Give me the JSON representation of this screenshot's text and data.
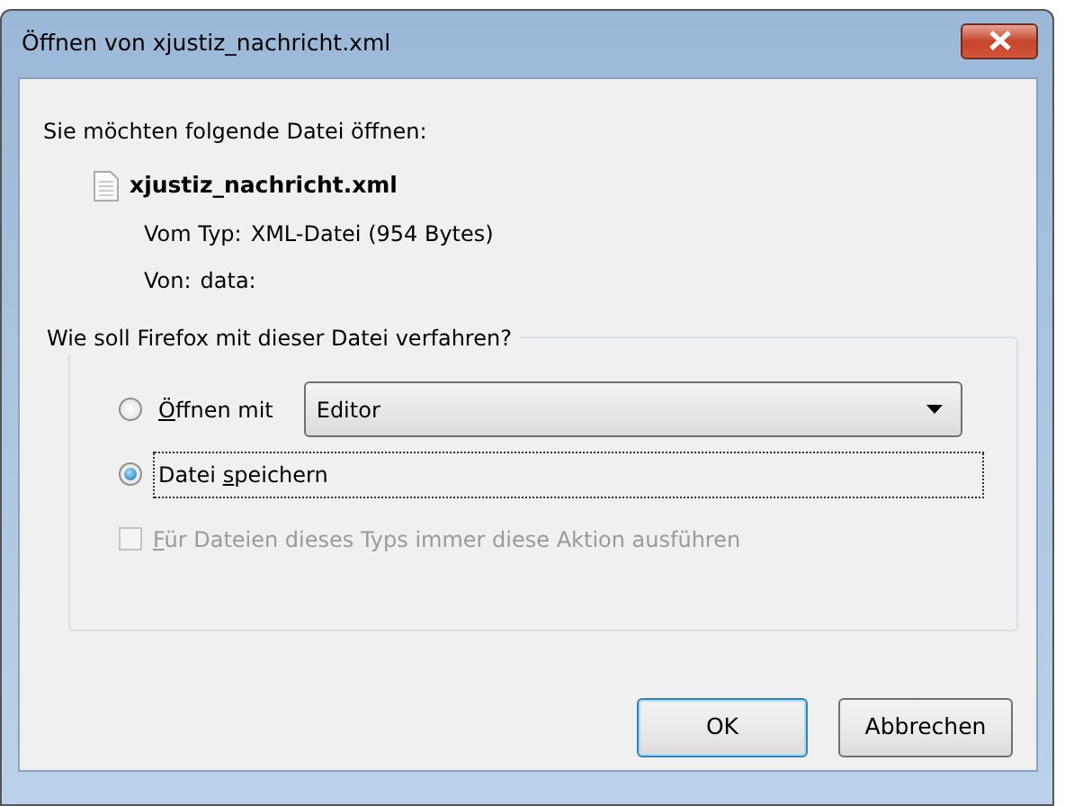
{
  "window": {
    "title": "Öffnen von xjustiz_nachricht.xml"
  },
  "prompt": "Sie möchten folgende Datei öffnen:",
  "file": {
    "name": "xjustiz_nachricht.xml",
    "type_label": "Vom Typ:",
    "type_value": "XML-Datei (954 Bytes)",
    "from_label": "Von:",
    "from_value": "data:"
  },
  "action_group": {
    "title": "Wie soll Firefox mit dieser Datei verfahren?",
    "options": [
      {
        "access_key": "Ö",
        "label_rest": "ffnen mit",
        "selected": false,
        "app": "Editor",
        "focused": false
      },
      {
        "label_start": "Datei ",
        "access_key": "s",
        "label_rest": "peichern",
        "selected": true,
        "focused": true
      }
    ],
    "remember": {
      "access_key": "F",
      "label_rest": "ür Dateien dieses Typs immer diese Aktion ausführen",
      "checked": false,
      "disabled": true
    }
  },
  "buttons": [
    {
      "label": "OK",
      "default": true
    },
    {
      "label": "Abbrechen",
      "default": false
    }
  ]
}
